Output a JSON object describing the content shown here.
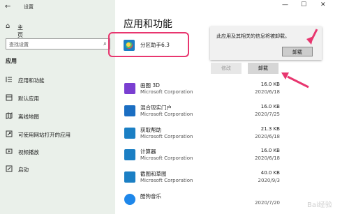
{
  "window": {
    "title": "设置",
    "minimize_icon": "minimize-icon",
    "maximize_icon": "maximize-icon",
    "close_icon": "close-icon"
  },
  "sidebar": {
    "home": "主页",
    "search_placeholder": "查找设置",
    "section": "应用",
    "items": [
      {
        "label": "应用和功能",
        "icon": "apps-list-icon",
        "active": true
      },
      {
        "label": "默认应用",
        "icon": "default-apps-icon",
        "active": false
      },
      {
        "label": "离线地图",
        "icon": "map-icon",
        "active": false
      },
      {
        "label": "可使用网站打开的应用",
        "icon": "open-with-website-icon",
        "active": false
      },
      {
        "label": "视频播放",
        "icon": "video-icon",
        "active": false
      },
      {
        "label": "启动",
        "icon": "startup-icon",
        "active": false
      }
    ]
  },
  "main": {
    "title": "应用和功能",
    "selected_app": {
      "name": "分区助手6.3",
      "icon": "partition-assistant-icon"
    },
    "popup": {
      "message": "此应用及其相关的信息将被卸载。",
      "button": "卸载"
    },
    "modify_button": "修改",
    "uninstall_button": "卸载",
    "apps": [
      {
        "name": "画图 3D",
        "publisher": "Microsoft Corporation",
        "size": "16.0 KB",
        "date": "2020/6/18",
        "icon": "paint3d-icon",
        "color": "#7a3fd1"
      },
      {
        "name": "混合现实门户",
        "publisher": "Microsoft Corporation",
        "size": "16.0 KB",
        "date": "2020/7/25",
        "icon": "mixed-reality-icon",
        "color": "#1b6ec2"
      },
      {
        "name": "获取帮助",
        "publisher": "Microsoft Corporation",
        "size": "21.3 KB",
        "date": "2020/6/18",
        "icon": "get-help-icon",
        "color": "#1b7fc4"
      },
      {
        "name": "计算器",
        "publisher": "Microsoft Corporation",
        "size": "16.0 KB",
        "date": "2020/6/18",
        "icon": "calculator-icon",
        "color": "#1b7fc4"
      },
      {
        "name": "截图和草图",
        "publisher": "Microsoft Corporation",
        "size": "40.0 KB",
        "date": "2020/9/3",
        "icon": "snip-sketch-icon",
        "color": "#1b7fc4"
      },
      {
        "name": "酷狗音乐",
        "publisher": "",
        "size": "",
        "date": "2020/7/20",
        "icon": "kugou-icon",
        "color": "#1e87ea"
      }
    ]
  },
  "watermark": "Bai经验"
}
